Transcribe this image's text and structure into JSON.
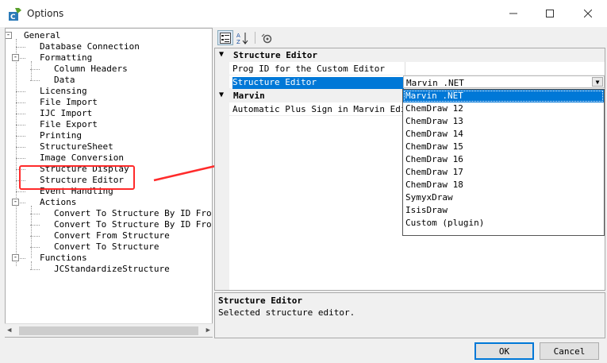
{
  "window": {
    "title": "Options",
    "minimize_icon": "minimize-icon",
    "maximize_icon": "maximize-icon",
    "close_icon": "close-icon"
  },
  "tree": {
    "items": [
      {
        "label": "General",
        "level": 0,
        "toggle": "-"
      },
      {
        "label": "Database Connection",
        "level": 1
      },
      {
        "label": "Formatting",
        "level": 1,
        "toggle": "-"
      },
      {
        "label": "Column Headers",
        "level": 2
      },
      {
        "label": "Data",
        "level": 2
      },
      {
        "label": "Licensing",
        "level": 1
      },
      {
        "label": "File Import",
        "level": 1
      },
      {
        "label": "IJC Import",
        "level": 1
      },
      {
        "label": "File Export",
        "level": 1
      },
      {
        "label": "Printing",
        "level": 1
      },
      {
        "label": "StructureSheet",
        "level": 1
      },
      {
        "label": "Image Conversion",
        "level": 1
      },
      {
        "label": "Structure Display",
        "level": 1
      },
      {
        "label": "Structure Editor",
        "level": 1
      },
      {
        "label": "Event Handling",
        "level": 1
      },
      {
        "label": "Actions",
        "level": 1,
        "toggle": "-"
      },
      {
        "label": "Convert To Structure By ID From I",
        "level": 2
      },
      {
        "label": "Convert To Structure By ID From C",
        "level": 2
      },
      {
        "label": "Convert From Structure",
        "level": 2
      },
      {
        "label": "Convert To Structure",
        "level": 2
      },
      {
        "label": "Functions",
        "level": 1,
        "toggle": "-"
      },
      {
        "label": "JCStandardizeStructure",
        "level": 2
      }
    ]
  },
  "toolbar": {
    "categorized_icon": "categorized-icon",
    "alphabetical_icon": "alphabetical-sort-icon",
    "property_pages_icon": "property-pages-icon"
  },
  "grid": {
    "categories": [
      {
        "label": "Structure Editor",
        "rows": [
          "Prog ID for the Custom Editor",
          "Structure Editor"
        ]
      },
      {
        "label": "Marvin",
        "rows": [
          "Automatic Plus Sign in Marvin Editor"
        ]
      }
    ],
    "selected_value": "Marvin .NET",
    "dropdown_options": [
      "Marvin .NET",
      "ChemDraw 12",
      "ChemDraw 13",
      "ChemDraw 14",
      "ChemDraw 15",
      "ChemDraw 16",
      "ChemDraw 17",
      "ChemDraw 18",
      "SymyxDraw",
      "IsisDraw",
      "Custom (plugin)"
    ]
  },
  "description": {
    "title": "Structure Editor",
    "text": "Selected structure editor."
  },
  "buttons": {
    "ok": "OK",
    "cancel": "Cancel"
  },
  "colors": {
    "selection": "#0078d7",
    "annotation": "#ff2b2b"
  }
}
